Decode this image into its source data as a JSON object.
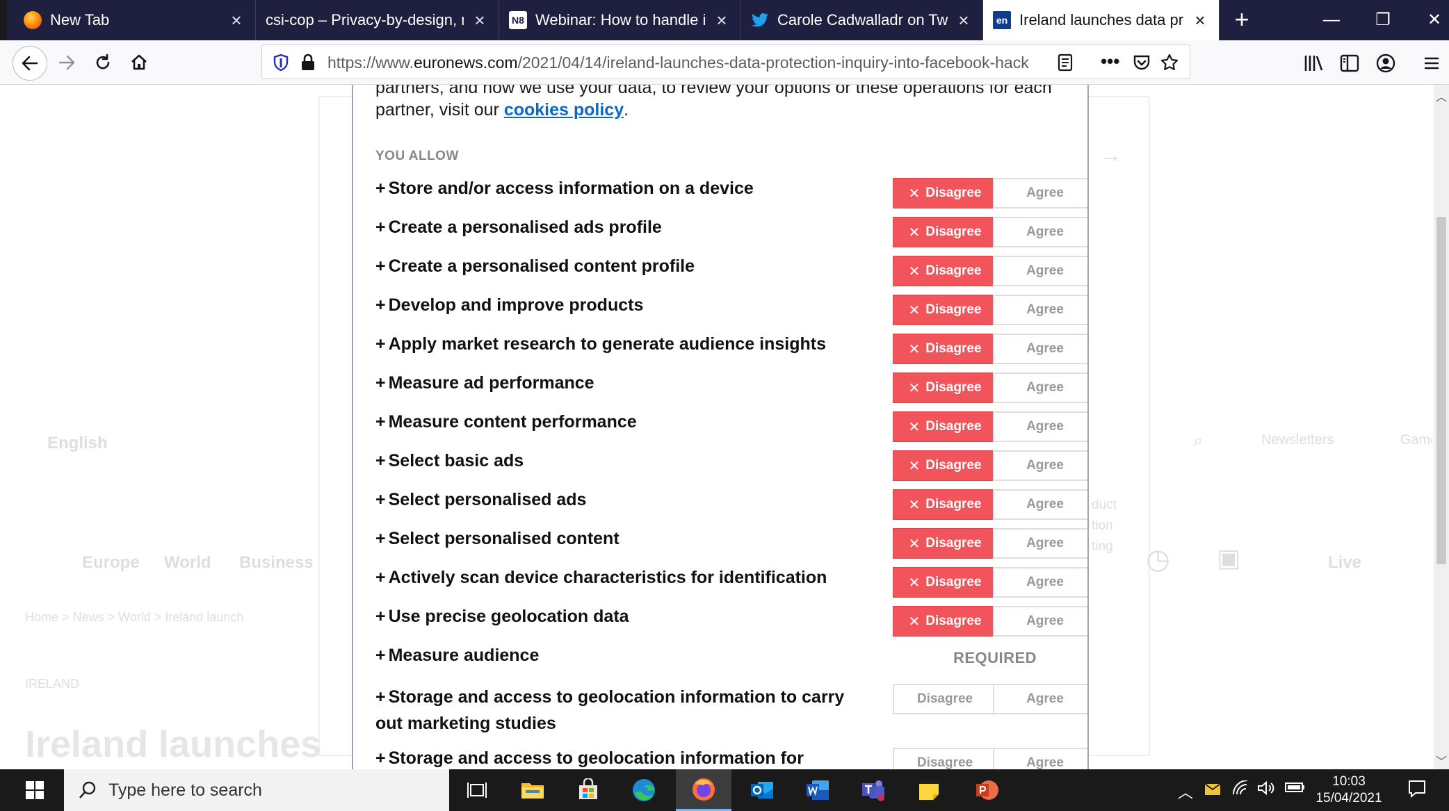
{
  "tabs": [
    {
      "title": "New Tab",
      "icon": "firefox-icon"
    },
    {
      "title": "csi-cop – Privacy-by-design, no tr",
      "icon": "none"
    },
    {
      "title": "Webinar: How to handle imp",
      "icon": "n8-icon",
      "favicon_text": "N8"
    },
    {
      "title": "Carole Cadwalladr on Twitter",
      "icon": "twitter-icon"
    },
    {
      "title": "Ireland launches data protect",
      "icon": "euronews-icon",
      "favicon_text": "en",
      "active": true
    }
  ],
  "url": {
    "prefix": "https://www.",
    "host": "euronews.com",
    "path": "/2021/04/14/ireland-launches-data-protection-inquiry-into-facebook-hack"
  },
  "background": {
    "language": "English",
    "nav_items": [
      "Europe",
      "World",
      "Business"
    ],
    "breadcrumb": [
      "Home",
      ">",
      "News",
      ">",
      "World",
      ">",
      "Ireland launch"
    ],
    "right_links": [
      "Newsletters",
      "Games",
      "Live"
    ],
    "frag_duct": "duct",
    "frag_tion": "tion",
    "frag_ting": "ting",
    "section_label": "IRELAND",
    "headline": "Ireland launches"
  },
  "consent": {
    "intro_cut": "partners, and how we use your data, to review your options or these operations for each",
    "intro_prefix": "partner, visit our ",
    "cookies_link": "cookies policy",
    "intro_suffix": ".",
    "section_title": "YOU ALLOW",
    "disagree_label": "Disagree",
    "agree_label": "Agree",
    "required_label": "REQUIRED",
    "purposes": [
      {
        "label": "Store and/or access information on a device",
        "state": "disagree"
      },
      {
        "label": "Create a personalised ads profile",
        "state": "disagree"
      },
      {
        "label": "Create a personalised content profile",
        "state": "disagree"
      },
      {
        "label": "Develop and improve products",
        "state": "disagree"
      },
      {
        "label": "Apply market research to generate audience insights",
        "state": "disagree"
      },
      {
        "label": "Measure ad performance",
        "state": "disagree"
      },
      {
        "label": "Measure content performance",
        "state": "disagree"
      },
      {
        "label": "Select basic ads",
        "state": "disagree"
      },
      {
        "label": "Select personalised ads",
        "state": "disagree"
      },
      {
        "label": "Select personalised content",
        "state": "disagree"
      },
      {
        "label": "Actively scan device characteristics for identification",
        "state": "disagree"
      },
      {
        "label": "Use precise geolocation data",
        "state": "disagree"
      },
      {
        "label": "Measure audience",
        "state": "required"
      },
      {
        "label": "Storage and access to geolocation information to carry out marketing studies",
        "state": "none"
      },
      {
        "label": "Storage and access to geolocation information for",
        "state": "none"
      }
    ]
  },
  "taskbar": {
    "search_placeholder": "Type here to search",
    "time": "10:03",
    "date": "15/04/2021"
  },
  "colors": {
    "tabbar": "#1f1f3f",
    "disagree_active": "#f2545b",
    "link": "#0a69c7"
  }
}
